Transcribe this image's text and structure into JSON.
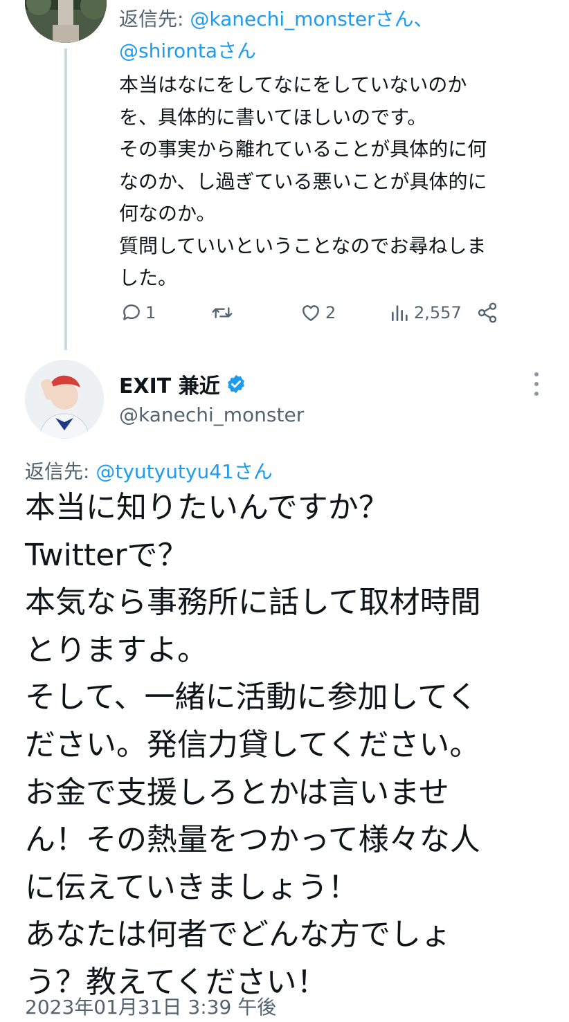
{
  "colors": {
    "text": "#0f1419",
    "secondary": "#536471",
    "link": "#1d9bf0",
    "verified": "#1d9bf0",
    "thread_line": "#cfd9de"
  },
  "tweet1": {
    "reply_prefix": "返信先: ",
    "reply_mention_1": "@kanechi_monsterさん、",
    "reply_mention_2": "@shirontaさん",
    "body": "本当はなにをしてなにをしていないのか\nを、具体的に書いてほしいのです。\nその事実から離れていることが具体的に何\nなのか、し過ぎている悪いことが具体的に\n何なのか。\n質問していいということなのでお尋ねしま\nした。",
    "actions": {
      "reply_count": "1",
      "retweet_count": "",
      "like_count": "2",
      "views_count": "2,557"
    },
    "icons": [
      "reply-icon",
      "retweet-icon",
      "like-icon",
      "views-icon",
      "share-icon"
    ]
  },
  "tweet2": {
    "display_name": "EXIT 兼近",
    "handle": "@kanechi_monster",
    "verified": true,
    "reply_prefix": "返信先: ",
    "reply_mention": "@tyutyutyu41さん",
    "body": "本当に知りたいんですか？\nTwitterで？\n本気なら事務所に話して取材時間\nとりますよ。\nそして、一緒に活動に参加してく\nださい。発信力貸してください。\nお金で支援しろとかは言いませ\nん！その熱量をつかって様々な人\nに伝えていきましょう！\nあなたは何者でどんな方でしょ\nう？教えてください！",
    "timestamp": "2023年01月31日 3:39 午後"
  }
}
